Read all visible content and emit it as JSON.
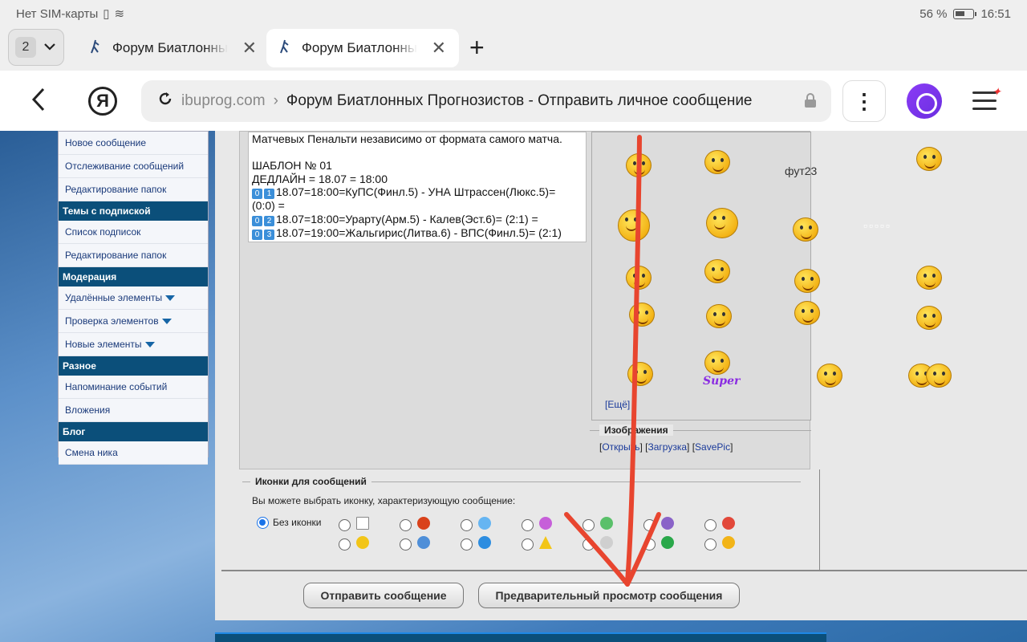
{
  "status": {
    "carrier": "Нет SIM-карты",
    "battery": "56 %",
    "time": "16:51"
  },
  "tabs": {
    "count": "2",
    "items": [
      {
        "title": "Форум Биатлонных Прогнозистов"
      },
      {
        "title": "Форум Биатлонных Прогнозистов"
      }
    ]
  },
  "address": {
    "domain": "ibuprog.com",
    "separator": "›",
    "page_title": "Форум Биатлонных Прогнозистов - Отправить личное сообщение"
  },
  "sidebar": {
    "items": [
      {
        "type": "item",
        "label": "Новое сообщение"
      },
      {
        "type": "item",
        "label": "Отслеживание сообщений"
      },
      {
        "type": "item",
        "label": "Редактирование папок"
      },
      {
        "type": "head",
        "label": "Темы с подпиской"
      },
      {
        "type": "item",
        "label": "Список подписок"
      },
      {
        "type": "item",
        "label": "Редактирование папок"
      },
      {
        "type": "head",
        "label": "Модерация"
      },
      {
        "type": "item",
        "label": "Удалённые элементы",
        "dropdown": true
      },
      {
        "type": "item",
        "label": "Проверка элементов",
        "dropdown": true
      },
      {
        "type": "item",
        "label": "Новые элементы",
        "dropdown": true
      },
      {
        "type": "head",
        "label": "Разное"
      },
      {
        "type": "item",
        "label": "Напоминание событий"
      },
      {
        "type": "item",
        "label": "Вложения"
      },
      {
        "type": "head",
        "label": "Блог"
      },
      {
        "type": "item",
        "label": "Смена ника"
      }
    ]
  },
  "editor": {
    "lines": [
      "Матчевых Пенальти независимо от формата самого матча.",
      "",
      "ШАБЛОН № 01",
      "ДЕДЛАЙН = 18.07 = 18:00",
      "18.07=18:00=КуПС(Финл.5) - УНА Штрассен(Люкс.5)=",
      "(0:0) =",
      "18.07=18:00=Урарту(Арм.5) - Калев(Эст.6)= (2:1) =",
      "18.07=19:00=Жальгирис(Литва.6) - ВПС(Финл.5)= (2:1)",
      "="
    ],
    "line_badges": [
      null,
      null,
      null,
      null,
      [
        "0",
        "1"
      ],
      null,
      [
        "0",
        "2"
      ],
      [
        "0",
        "3"
      ],
      null
    ]
  },
  "smilies": {
    "broken_alt": "фут23",
    "more_link": "[Ещё]"
  },
  "images_section": {
    "title": "Изображения",
    "links": [
      "Открыть",
      "Загрузка",
      "SavePic"
    ]
  },
  "message_icons": {
    "title": "Иконки для сообщений",
    "description": "Вы можете выбрать иконку, характеризующую сообщение:",
    "no_icon_label": "Без иконки"
  },
  "buttons": {
    "send": "Отправить сообщение",
    "preview": "Предварительный просмотр сообщения"
  },
  "colors": {
    "sidebar_head": "#0b4f7a",
    "link": "#1a3a7a",
    "arrow": "#e8452f",
    "alice": "#7b34f0"
  }
}
